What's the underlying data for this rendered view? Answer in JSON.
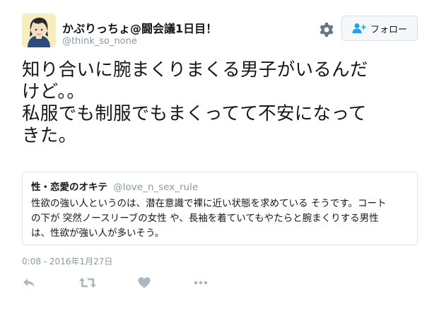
{
  "user": {
    "display_name": "かぷりっちょ@闘会議1日目！",
    "handle": "@think_so_none"
  },
  "header": {
    "follow_label": "フォロー",
    "gear_icon": "gear-icon",
    "follow_icon": "add-user-icon"
  },
  "tweet": {
    "lines": [
      "知り合いに腕まくりまくる男子がいるんだ",
      "けど。。",
      "私服でも制服でもまくってて不安になって",
      "きた。"
    ]
  },
  "quote": {
    "name": "性・恋愛のオキテ",
    "handle": "@love_n_sex_rule",
    "lines": [
      "性欲の強い人というのは、潜在意識で裸に近い状態を求めている そうです。コート",
      "の下が 突然ノースリーブの女性 や、長袖を着ていてもやたらと腕まくりする男性",
      "は、性欲が強い人が多いそう。"
    ]
  },
  "timestamp": "0:08 - 2016年1月27日",
  "actions": {
    "icons": [
      "reply-icon",
      "retweet-icon",
      "like-icon",
      "more-icon"
    ]
  },
  "colors": {
    "text": "#14171a",
    "muted": "#8899a6",
    "icon": "#aab8c2",
    "border": "#e1e8ed",
    "follow_bg": "#f5f8fa",
    "follow_icon": "#1da1f2"
  }
}
